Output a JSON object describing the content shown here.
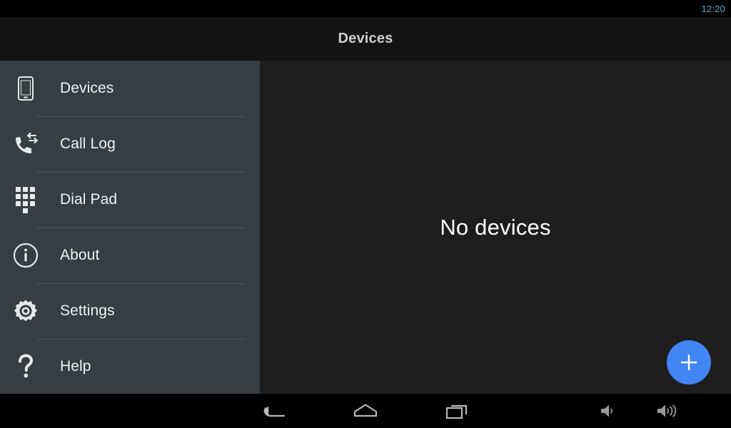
{
  "status_bar": {
    "clock": "12:20",
    "clock_color": "#5aa8c8"
  },
  "action_bar": {
    "title": "Devices"
  },
  "sidebar": {
    "background_color": "#373d40",
    "items": [
      {
        "label": "Devices",
        "icon": "smartphone-icon"
      },
      {
        "label": "Call Log",
        "icon": "call-log-icon"
      },
      {
        "label": "Dial Pad",
        "icon": "dialpad-icon"
      },
      {
        "label": "About",
        "icon": "info-circle-icon"
      },
      {
        "label": "Settings",
        "icon": "gear-icon"
      },
      {
        "label": "Help",
        "icon": "question-mark-icon"
      }
    ]
  },
  "main": {
    "empty_message": "No devices",
    "background_color": "#1e1e1e",
    "fab": {
      "icon": "plus-icon",
      "color": "#4285f4",
      "label": "Add device"
    }
  },
  "navigation_bar": {
    "background_color": "#000000",
    "buttons": [
      {
        "name": "back",
        "icon": "back-arrow-icon"
      },
      {
        "name": "home",
        "icon": "home-icon"
      },
      {
        "name": "recents",
        "icon": "recents-icon"
      },
      {
        "name": "volume_down",
        "icon": "volume-down-icon"
      },
      {
        "name": "volume_up",
        "icon": "volume-up-icon"
      }
    ]
  }
}
